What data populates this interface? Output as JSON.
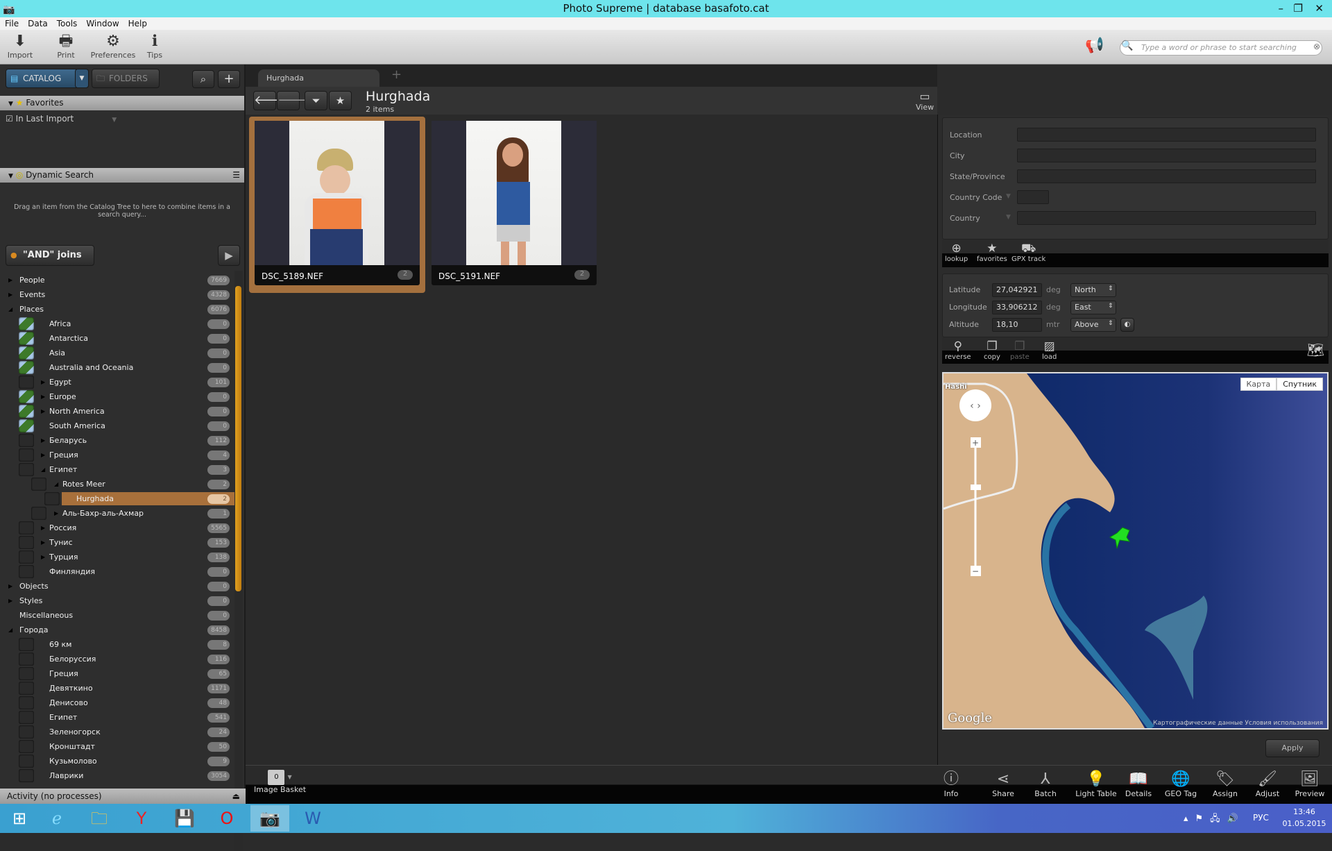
{
  "window": {
    "title": "Photo Supreme | database basafoto.cat"
  },
  "menu": [
    "File",
    "Data",
    "Tools",
    "Window",
    "Help"
  ],
  "toolbar": [
    {
      "label": "Import",
      "icon": "import-icon"
    },
    {
      "label": "Print",
      "icon": "print-icon"
    },
    {
      "label": "Preferences",
      "icon": "gear-icon"
    },
    {
      "label": "Tips",
      "icon": "tips-icon"
    }
  ],
  "search": {
    "placeholder": "Type a word or phrase to start searching"
  },
  "left": {
    "catalog_tab": "CATALOG",
    "folders_tab": "FOLDERS",
    "favorites": {
      "title": "Favorites",
      "items": [
        "In Last Import"
      ]
    },
    "dynamic_search": {
      "title": "Dynamic Search",
      "hint": "Drag an item from the Catalog Tree to here to combine items in a search query...",
      "join_label": "\"AND\" joins"
    },
    "tree": [
      {
        "label": "People",
        "count": "7669",
        "level": 0,
        "exp": "right"
      },
      {
        "label": "Events",
        "count": "4328",
        "level": 0,
        "exp": "right"
      },
      {
        "label": "Places",
        "count": "6076",
        "level": 0,
        "exp": "down"
      },
      {
        "label": "Africa",
        "count": "0",
        "level": 1,
        "exp": "",
        "thumb": "map"
      },
      {
        "label": "Antarctica",
        "count": "0",
        "level": 1,
        "exp": "",
        "thumb": "map"
      },
      {
        "label": "Asia",
        "count": "0",
        "level": 1,
        "exp": "",
        "thumb": "map"
      },
      {
        "label": "Australia and Oceania",
        "count": "0",
        "level": 1,
        "exp": "",
        "thumb": "map"
      },
      {
        "label": "Egypt",
        "count": "101",
        "level": 1,
        "exp": "right",
        "thumb": "blank"
      },
      {
        "label": "Europe",
        "count": "0",
        "level": 1,
        "exp": "right",
        "thumb": "map"
      },
      {
        "label": "North America",
        "count": "0",
        "level": 1,
        "exp": "right",
        "thumb": "map"
      },
      {
        "label": "South America",
        "count": "0",
        "level": 1,
        "exp": "",
        "thumb": "map"
      },
      {
        "label": "Беларусь",
        "count": "112",
        "level": 1,
        "exp": "right",
        "thumb": "blank"
      },
      {
        "label": "Греция",
        "count": "4",
        "level": 1,
        "exp": "right",
        "thumb": "blank"
      },
      {
        "label": "Египет",
        "count": "3",
        "level": 1,
        "exp": "down",
        "thumb": "blank"
      },
      {
        "label": "Rotes Meer",
        "count": "2",
        "level": 2,
        "exp": "down",
        "thumb": "blank"
      },
      {
        "label": "Hurghada",
        "count": "2",
        "level": 3,
        "exp": "",
        "thumb": "blank",
        "selected": true
      },
      {
        "label": "Аль-Бахр-аль-Ахмар",
        "count": "1",
        "level": 2,
        "exp": "right",
        "thumb": "blank"
      },
      {
        "label": "Россия",
        "count": "5565",
        "level": 1,
        "exp": "right",
        "thumb": "blank"
      },
      {
        "label": "Тунис",
        "count": "153",
        "level": 1,
        "exp": "right",
        "thumb": "blank"
      },
      {
        "label": "Турция",
        "count": "138",
        "level": 1,
        "exp": "right",
        "thumb": "blank"
      },
      {
        "label": "Финляндия",
        "count": "0",
        "level": 1,
        "exp": "",
        "thumb": "blank"
      },
      {
        "label": "Objects",
        "count": "0",
        "level": 0,
        "exp": "right"
      },
      {
        "label": "Styles",
        "count": "0",
        "level": 0,
        "exp": "right"
      },
      {
        "label": "Miscellaneous",
        "count": "0",
        "level": 0,
        "exp": ""
      },
      {
        "label": "Города",
        "count": "8458",
        "level": 0,
        "exp": "down"
      },
      {
        "label": "69 км",
        "count": "8",
        "level": 1,
        "exp": "",
        "thumb": "blank"
      },
      {
        "label": "Белоруссия",
        "count": "116",
        "level": 1,
        "exp": "",
        "thumb": "blank"
      },
      {
        "label": "Греция",
        "count": "65",
        "level": 1,
        "exp": "",
        "thumb": "blank"
      },
      {
        "label": "Девяткино",
        "count": "1171",
        "level": 1,
        "exp": "",
        "thumb": "blank"
      },
      {
        "label": "Денисово",
        "count": "48",
        "level": 1,
        "exp": "",
        "thumb": "blank"
      },
      {
        "label": "Египет",
        "count": "541",
        "level": 1,
        "exp": "",
        "thumb": "blank"
      },
      {
        "label": "Зеленогорск",
        "count": "24",
        "level": 1,
        "exp": "",
        "thumb": "blank"
      },
      {
        "label": "Кронштадт",
        "count": "50",
        "level": 1,
        "exp": "",
        "thumb": "blank"
      },
      {
        "label": "Кузьмолово",
        "count": "9",
        "level": 1,
        "exp": "",
        "thumb": "blank"
      },
      {
        "label": "Лаврики",
        "count": "3054",
        "level": 1,
        "exp": "",
        "thumb": "blank"
      }
    ],
    "activity": "Activity (no processes)"
  },
  "center": {
    "tab": "Hurghada",
    "title": "Hurghada",
    "subtitle": "2 items",
    "view_label": "View",
    "thumbnails": [
      {
        "name": "DSC_5189.NEF",
        "count": "2",
        "selected": true
      },
      {
        "name": "DSC_5191.NEF",
        "count": "2",
        "selected": false
      }
    ],
    "basket": {
      "label": "Image Basket",
      "count": "0"
    }
  },
  "geo": {
    "fields": [
      {
        "label": "Location",
        "value": ""
      },
      {
        "label": "City",
        "value": ""
      },
      {
        "label": "State/Province",
        "value": ""
      },
      {
        "label": "Country Code",
        "value": ""
      },
      {
        "label": "Country",
        "value": ""
      }
    ],
    "strip1": [
      "lookup",
      "favorites",
      "GPX track"
    ],
    "coords": [
      {
        "label": "Latitude",
        "value": "27,042921",
        "unit": "deg",
        "dir": "North"
      },
      {
        "label": "Longitude",
        "value": "33,906212",
        "unit": "deg",
        "dir": "East"
      },
      {
        "label": "Altitude",
        "value": "18,10",
        "unit": "mtr",
        "dir": "Above"
      }
    ],
    "strip2": [
      "reverse",
      "copy",
      "paste",
      "load"
    ],
    "map": {
      "type_map": "Карта",
      "type_sat": "Спутник",
      "active_type": "Спутник",
      "place_label": "Hashi",
      "logo": "Google",
      "attribution": "Картографические данные   Условия использования"
    },
    "apply": "Apply"
  },
  "bottom": [
    "Info",
    "Share",
    "Batch",
    "Light Table",
    "Details",
    "GEO Tag",
    "Assign",
    "Adjust",
    "Preview"
  ],
  "taskbar": {
    "lang": "РУС",
    "time": "13:46",
    "date": "01.05.2015"
  }
}
